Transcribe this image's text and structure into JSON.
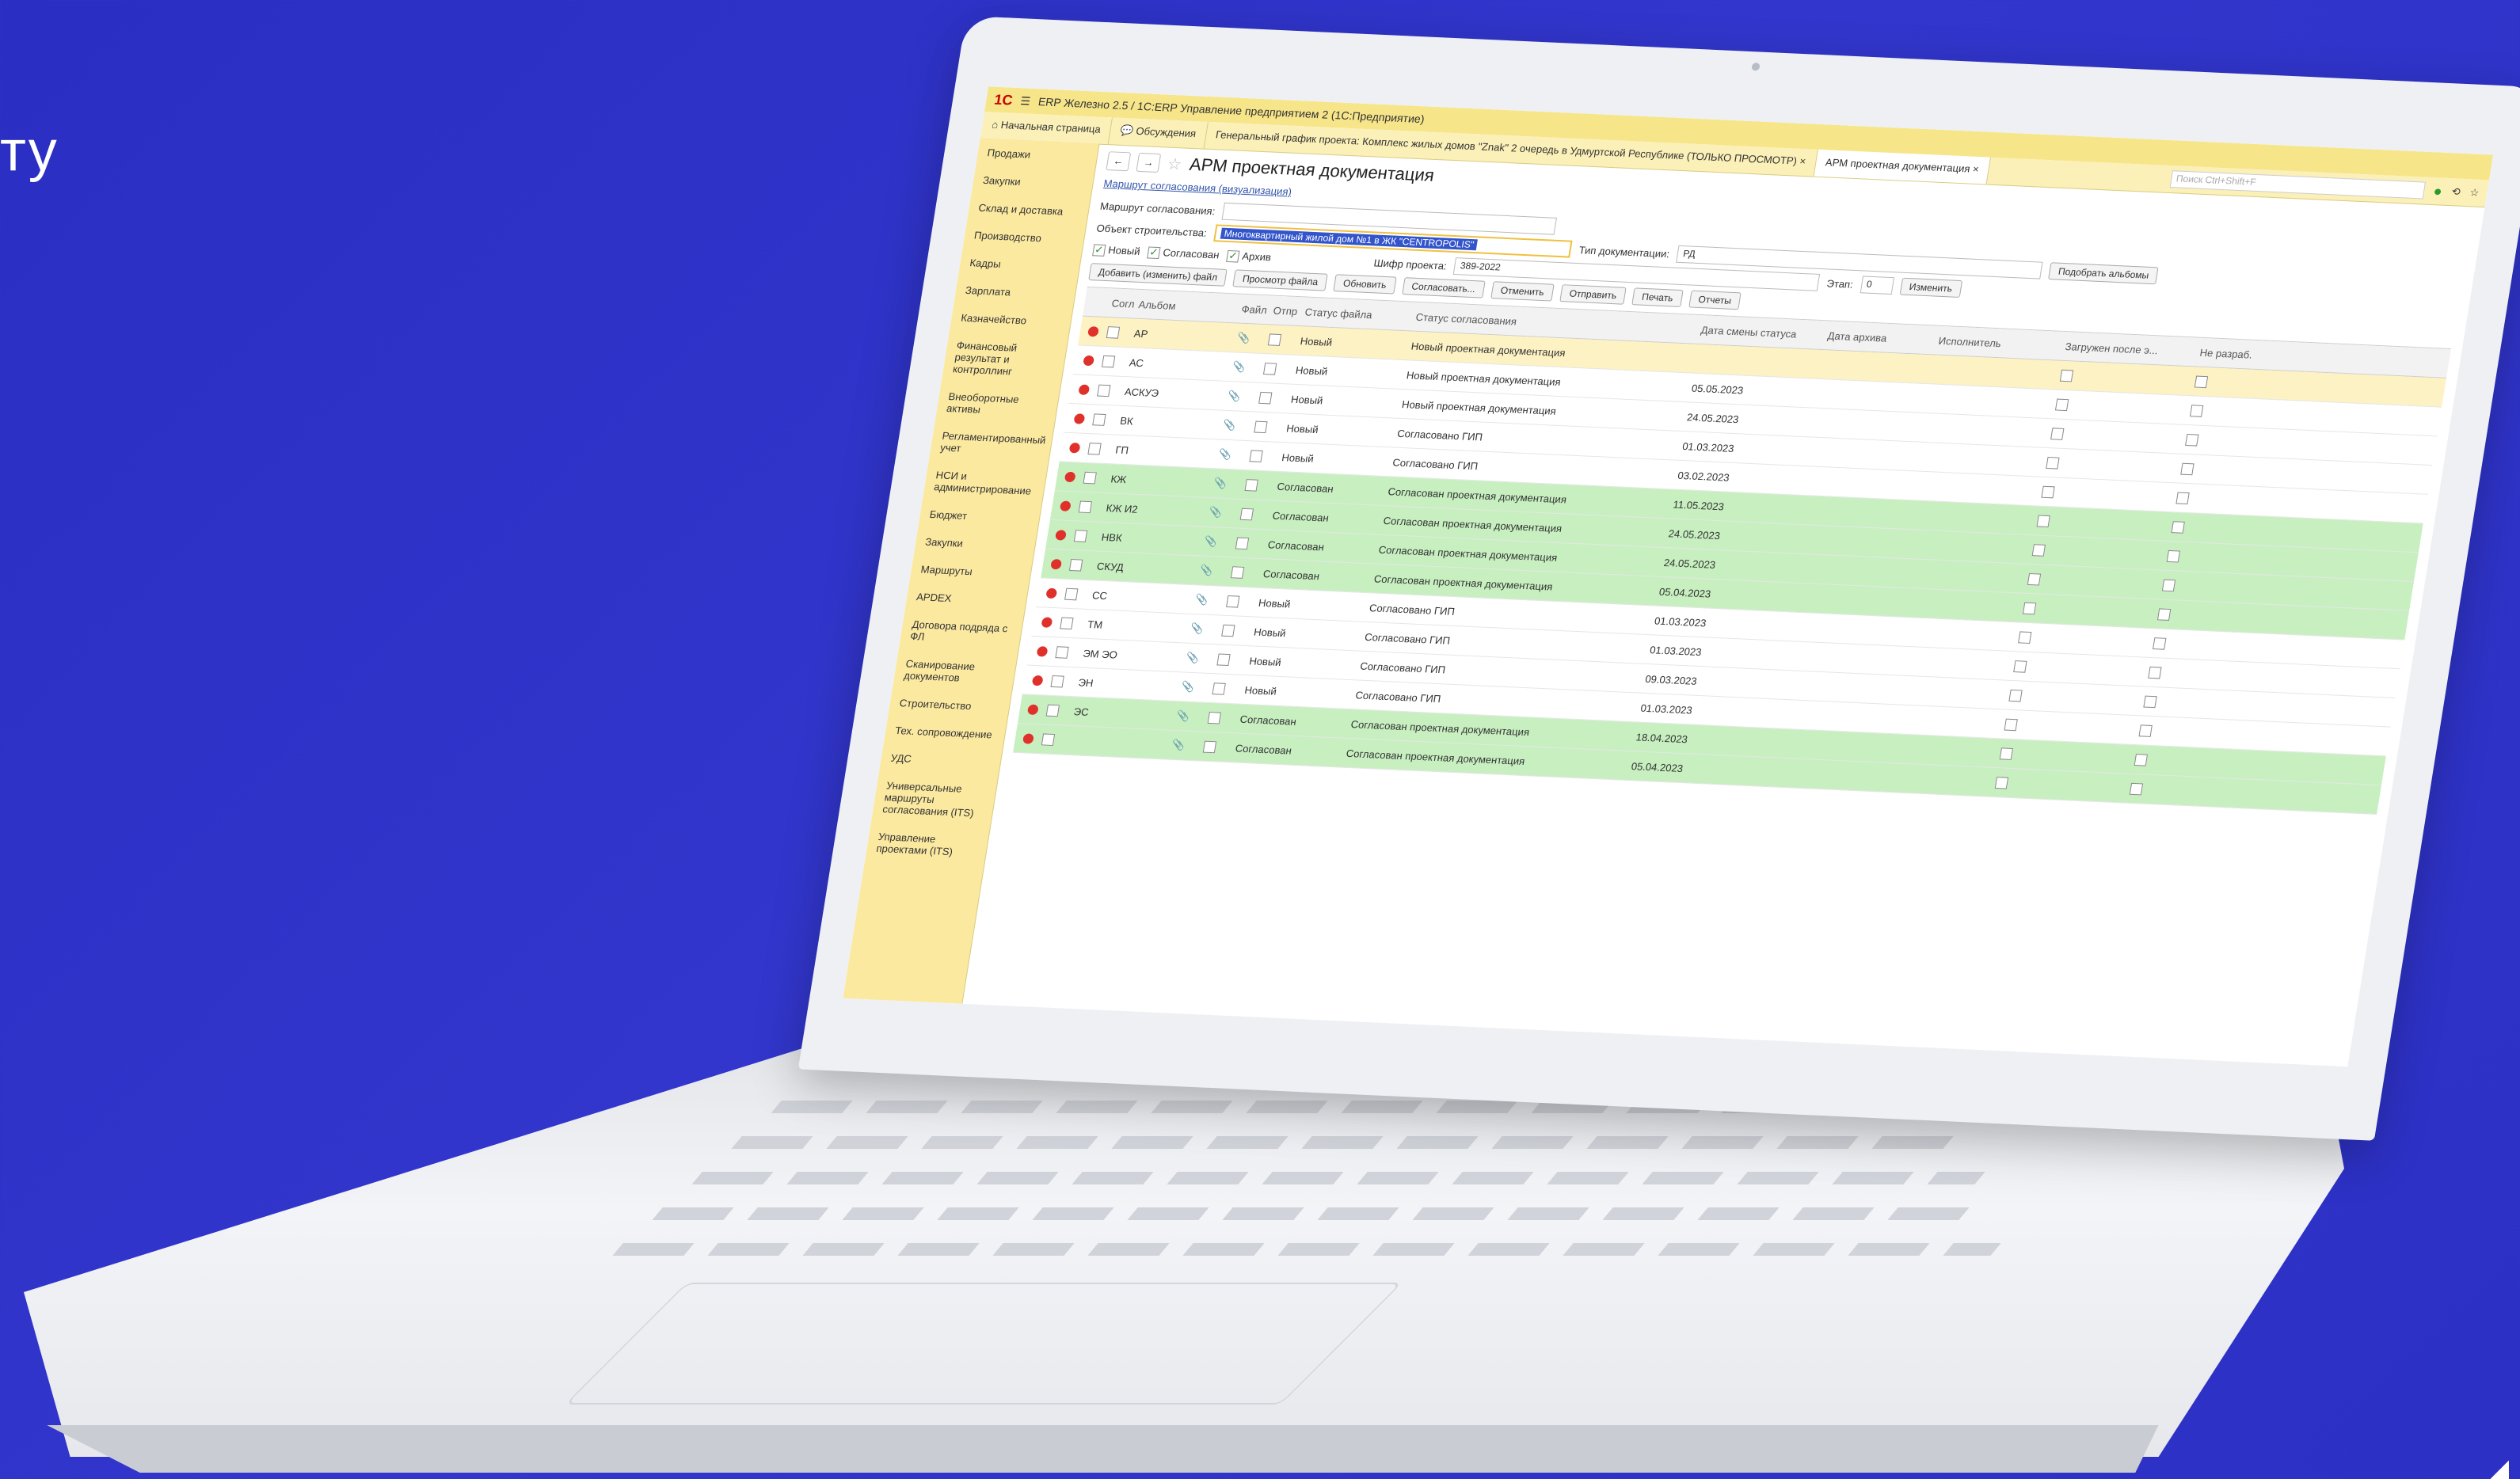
{
  "page": {
    "side_text": "ту"
  },
  "app": {
    "title": "ERP Железно 2.5 / 1С:ERP Управление предприятием 2 (1С:Предприятие)",
    "tabs": [
      {
        "label": "Начальная страница"
      },
      {
        "label": "Обсуждения"
      },
      {
        "label": "Генеральный график проекта: Комплекс жилых домов \"Znak\" 2 очередь в Удмуртской Республике (ТОЛЬКО ПРОСМОТР)"
      },
      {
        "label": "АРМ проектная документация"
      }
    ],
    "search_placeholder": "Поиск Ctrl+Shift+F",
    "sidebar": [
      "Продажи",
      "Закупки",
      "Склад и доставка",
      "Производство",
      "Кадры",
      "Зарплата",
      "Казначейство",
      "Финансовый результат и контроллинг",
      "Внеоборотные активы",
      "Регламентированный учет",
      "НСИ и администрирование",
      "Бюджет",
      "Закупки",
      "Маршруты",
      "APDEX",
      "Договора подряда с ФЛ",
      "Сканирование документов",
      "Строительство",
      "Тех. сопровождение",
      "УДС",
      "Универсальные маршруты согласования (ITS)",
      "Управление проектами (ITS)"
    ],
    "form": {
      "title": "АРМ проектная документация",
      "route_link": "Маршрут согласования (визуализация)",
      "route_label": "Маршрут согласования:",
      "object_label": "Объект строительства:",
      "object_value": "Многоквартирный жилой дом №1 в ЖК \"CENTROPOLIS\"",
      "doc_type_label": "Тип документации:",
      "doc_type_value": "РД",
      "pick_albums": "Подобрать альбомы",
      "filter_new": "Новый",
      "filter_agreed": "Согласован",
      "filter_archive": "Архив",
      "cipher_label": "Шифр проекта:",
      "cipher_value": "389-2022",
      "stage_label": "Этап:",
      "stage_value": "0",
      "change_btn": "Изменить",
      "toolbar": [
        "Добавить (изменить) файл",
        "Просмотр файла",
        "Обновить",
        "Согласовать...",
        "Отменить",
        "Отправить",
        "Печать",
        "Отчеты"
      ]
    },
    "grid": {
      "headers": [
        "",
        "Согл",
        "Альбом",
        "Файл",
        "Отпр",
        "Статус файла",
        "Статус согласования",
        "Дата смены статуса",
        "Дата архива",
        "Исполнитель",
        "Загружен после э...",
        "Не разраб."
      ],
      "rows": [
        {
          "album": "АР",
          "file_status": "Новый",
          "approval": "Новый проектная документация",
          "date": "",
          "style": "cur"
        },
        {
          "album": "АС",
          "file_status": "Новый",
          "approval": "Новый проектная документация",
          "date": "05.05.2023",
          "style": ""
        },
        {
          "album": "АСКУЭ",
          "file_status": "Новый",
          "approval": "Новый проектная документация",
          "date": "24.05.2023",
          "style": ""
        },
        {
          "album": "ВК",
          "file_status": "Новый",
          "approval": "Согласовано ГИП",
          "date": "01.03.2023",
          "style": ""
        },
        {
          "album": "ГП",
          "file_status": "Новый",
          "approval": "Согласовано ГИП",
          "date": "03.02.2023",
          "style": ""
        },
        {
          "album": "КЖ",
          "file_status": "Согласован",
          "approval": "Согласован проектная документация",
          "date": "11.05.2023",
          "style": "green"
        },
        {
          "album": "КЖ И2",
          "file_status": "Согласован",
          "approval": "Согласован проектная документация",
          "date": "24.05.2023",
          "style": "green"
        },
        {
          "album": "НВК",
          "file_status": "Согласован",
          "approval": "Согласован проектная документация",
          "date": "24.05.2023",
          "style": "green"
        },
        {
          "album": "СКУД",
          "file_status": "Согласован",
          "approval": "Согласован проектная документация",
          "date": "05.04.2023",
          "style": "green"
        },
        {
          "album": "СС",
          "file_status": "Новый",
          "approval": "Согласовано ГИП",
          "date": "01.03.2023",
          "style": ""
        },
        {
          "album": "ТМ",
          "file_status": "Новый",
          "approval": "Согласовано ГИП",
          "date": "01.03.2023",
          "style": ""
        },
        {
          "album": "ЭМ ЭО",
          "file_status": "Новый",
          "approval": "Согласовано ГИП",
          "date": "09.03.2023",
          "style": ""
        },
        {
          "album": "ЭН",
          "file_status": "Новый",
          "approval": "Согласовано ГИП",
          "date": "01.03.2023",
          "style": ""
        },
        {
          "album": "ЭС",
          "file_status": "Согласован",
          "approval": "Согласован проектная документация",
          "date": "18.04.2023",
          "style": "green"
        },
        {
          "album": "",
          "file_status": "Согласован",
          "approval": "Согласован проектная документация",
          "date": "05.04.2023",
          "style": "green"
        }
      ]
    }
  }
}
